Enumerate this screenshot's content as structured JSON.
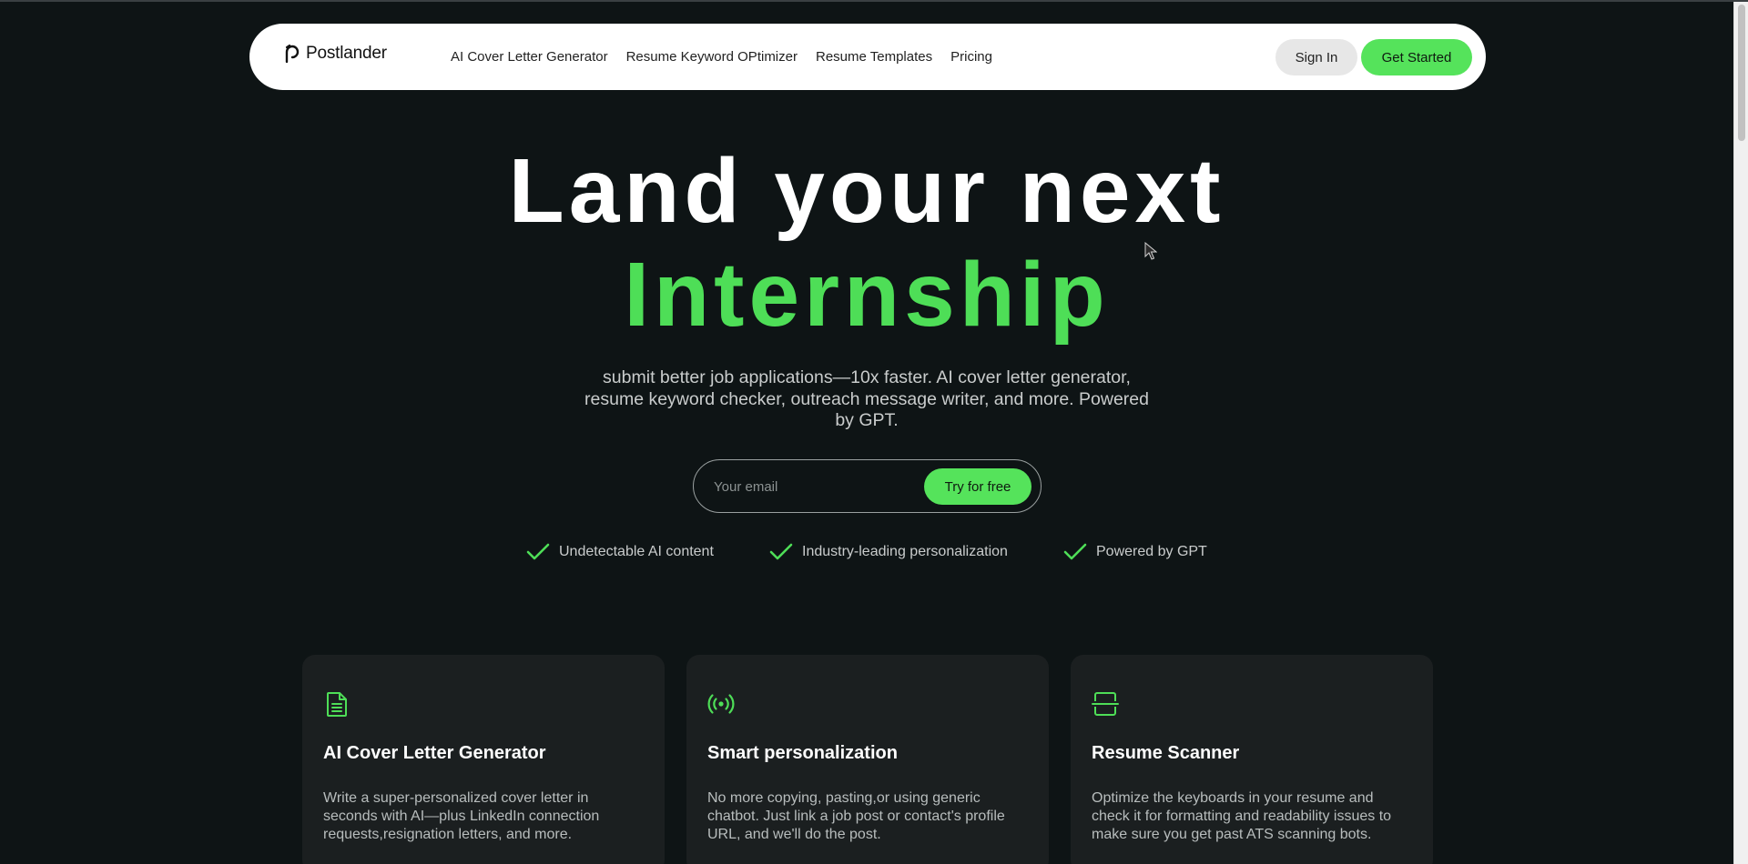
{
  "brand": {
    "name": "Postlander",
    "accent": "#55e35b"
  },
  "nav": {
    "links": [
      "AI Cover Letter Generator",
      "Resume Keyword OPtimizer",
      "Resume Templates",
      "Pricing"
    ],
    "sign_in": "Sign In",
    "get_started": "Get Started"
  },
  "hero": {
    "line1": "Land your next",
    "line2": "Internship",
    "subtitle": "submit better job applications—10x faster. AI cover letter generator, resume keyword checker, outreach message writer, and more. Powered by GPT."
  },
  "signup": {
    "placeholder": "Your email",
    "button": "Try for free"
  },
  "features": [
    {
      "icon": "check-icon",
      "label": "Undetectable AI content"
    },
    {
      "icon": "check-icon",
      "label": "Industry-leading personalization"
    },
    {
      "icon": "check-icon",
      "label": "Powered by GPT"
    }
  ],
  "cards": [
    {
      "icon": "document-icon",
      "title": "AI Cover Letter Generator",
      "text": "Write a super-personalized cover letter in seconds with AI—plus LinkedIn connection requests,resignation letters, and more."
    },
    {
      "icon": "broadcast-icon",
      "title": "Smart personalization",
      "text": "No more copying, pasting,or using generic chatbot. Just link a job post or contact's profile URL, and we'll do the post."
    },
    {
      "icon": "scanner-icon",
      "title": "Resume Scanner",
      "text": "Optimize the keyboards in your resume and check it for formatting and readability issues to make sure you get past ATS scanning bots."
    }
  ]
}
